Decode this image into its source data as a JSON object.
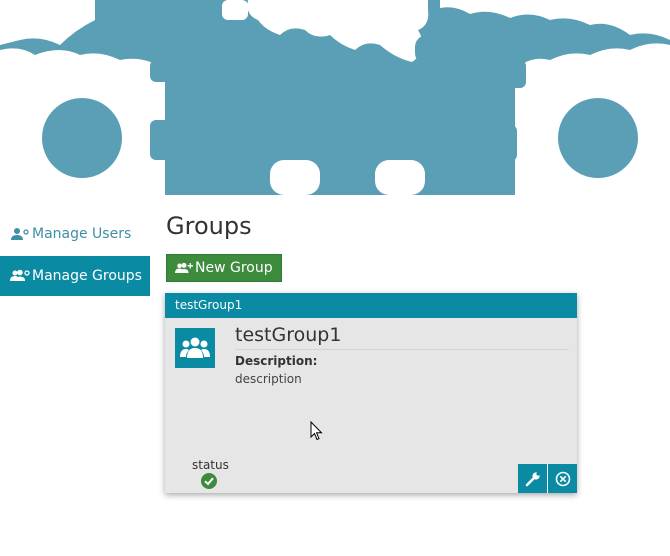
{
  "sidebar": {
    "items": [
      {
        "label": "Manage Users",
        "icon": "user-gear-icon",
        "active": false
      },
      {
        "label": "Manage Groups",
        "icon": "group-gear-icon",
        "active": true
      }
    ]
  },
  "main": {
    "title": "Groups",
    "new_group_label": "New Group"
  },
  "group_card": {
    "header": "testGroup1",
    "title": "testGroup1",
    "description_label": "Description:",
    "description": "description",
    "status_label": "status",
    "status_icon": "check-circle-icon"
  },
  "colors": {
    "accent": "#0a8aa3",
    "banner_gear": "#5b9fb6",
    "success": "#3d8b3d",
    "card_bg": "#e6e6e6"
  }
}
